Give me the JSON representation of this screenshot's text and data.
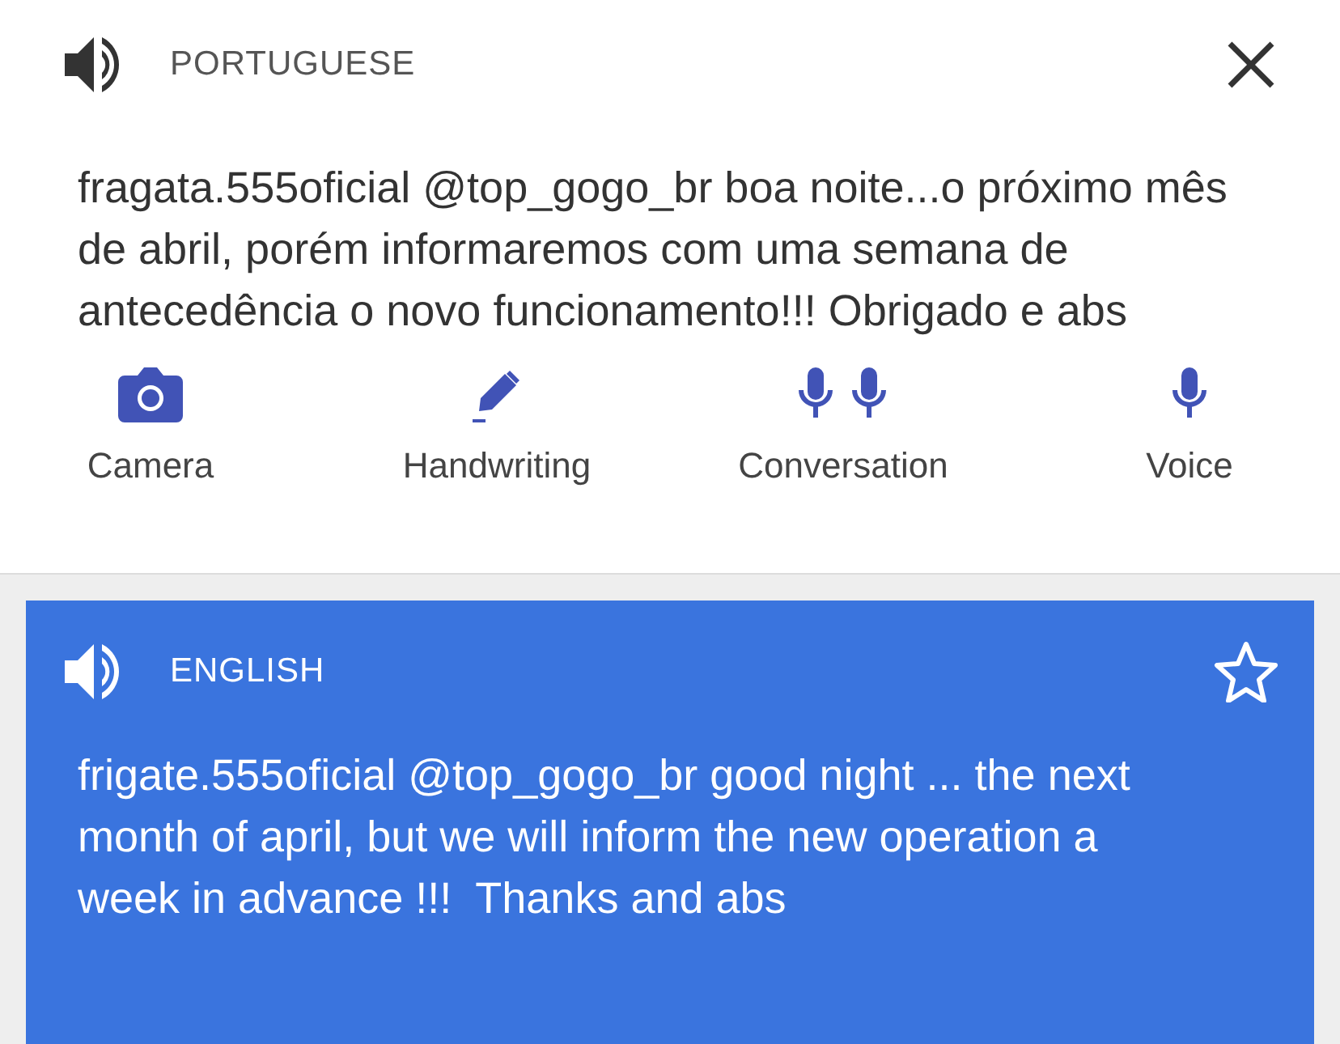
{
  "source": {
    "language": "PORTUGUESE",
    "text": "fragata.555oficial @top_gogo_br boa noite...o próximo mês de abril, porém informaremos com uma semana de antecedência o novo funcionamento!!! Obrigado e abs"
  },
  "tools": [
    {
      "label": "Camera",
      "kind": "camera"
    },
    {
      "label": "Handwriting",
      "kind": "pen"
    },
    {
      "label": "Conversation",
      "kind": "conversation"
    },
    {
      "label": "Voice",
      "kind": "mic"
    }
  ],
  "target": {
    "language": "ENGLISH",
    "starred": false,
    "text": "frigate.555oficial @top_gogo_br good night ... the next month of april, but we will inform the new operation a week in advance !!!  Thanks and abs"
  }
}
